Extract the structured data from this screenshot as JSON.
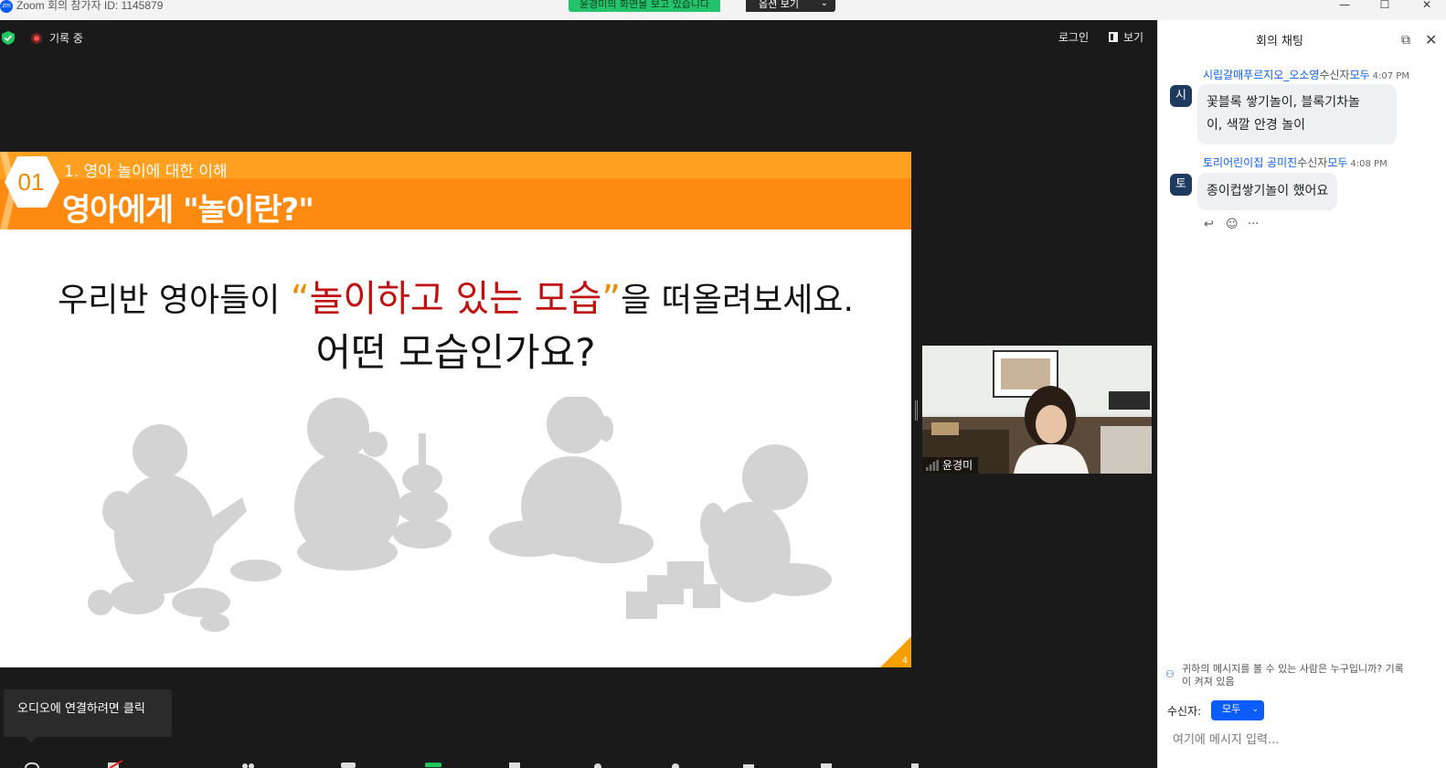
{
  "window": {
    "app_logo": "zm",
    "title": "Zoom 회의 참가자 ID: 1145879",
    "minimize": "—",
    "maximize": "☐",
    "close": "✕"
  },
  "share_banner": {
    "text": "윤경미의 화면을 보고 있습니다",
    "options_label": "옵션 보기",
    "options_chevron": "⌄"
  },
  "meeting": {
    "recording_label": "기록 중",
    "login_label": "로그인",
    "view_label": "보기"
  },
  "slide": {
    "number": "01",
    "subtitle": "1. 영아 놀이에 대한 이해",
    "title": "영아에게 \"놀이란?\"",
    "line1_before": "우리반 영아들이 ",
    "quote_open": "“",
    "line1_highlight": "놀이하고 있는 모습",
    "quote_close": "”",
    "line1_after": "을 떠올려보세요.",
    "line2": "어떤 모습인가요?",
    "page_number": "4"
  },
  "video": {
    "participant_name": "윤경미"
  },
  "tooltip": {
    "text": "오디오에 연결하려면 클릭"
  },
  "chat": {
    "header": "회의 채팅",
    "popout_icon": "⧉",
    "close_icon": "✕",
    "messages": [
      {
        "avatar": "시",
        "sender": "시립갈매푸르지오_오소영",
        "to_label": "수신자",
        "recipient": "모두",
        "time": "4:07 PM",
        "lines": [
          "꽃블록 쌓기놀이, 블록기차놀",
          "이, 색깔 안경 놀이"
        ]
      },
      {
        "avatar": "토",
        "sender": "토리어린이집 공미진",
        "to_label": "수신자",
        "recipient": "모두",
        "time": "4:08 PM",
        "lines": [
          "종이컵쌓기놀이 했어요"
        ]
      }
    ],
    "reactions": {
      "reply": "↩",
      "emoji": "☺",
      "more": "···"
    },
    "visibility_line1": "귀하의 메시지를 볼 수 있는 사람은 누구입니까? 기록",
    "visibility_line2": "이 켜져 있음",
    "to_label": "수신자:",
    "to_value": "모두",
    "to_chevron": "⌄",
    "input_placeholder": "여기에 메시지 입력..."
  }
}
